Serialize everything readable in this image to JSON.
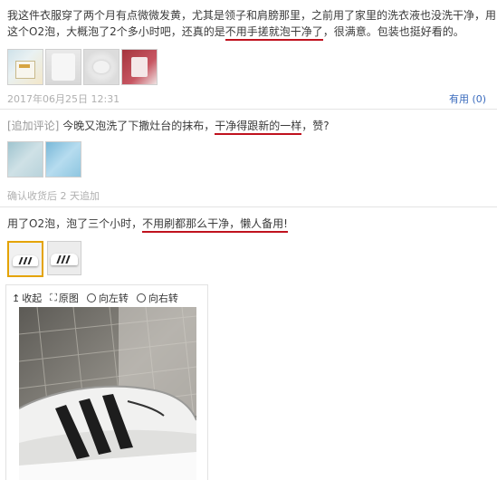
{
  "review1": {
    "line1_a": "我这件衣服穿了两个月有点微微发黄，尤其是领子和肩膀那里，之前用了家里的洗衣液也没洗干净，用",
    "line2_a": "这个O2泡，大概泡了2个多小时吧，还真的是",
    "line2_highlight": "不用手搓就泡干净了",
    "line2_b": "，很满意。包装也挺好看的。",
    "date": "2017年06月25日 12:31",
    "useful": "有用 (0)"
  },
  "followup": {
    "tag": "[追加评论]",
    "text_a": "今晚又泡洗了下撒灶台的抹布，",
    "text_highlight": "干净得跟新的一样",
    "text_b": "，赞?",
    "time": "确认收货后 2 天追加"
  },
  "review2": {
    "text_a": "用了O2泡，泡了三个小时，",
    "text_highlight": "不用刷都那么干净，懒人备用!",
    "toolbar": {
      "collapse": "收起",
      "original": "原图",
      "rotate_left": "向左转",
      "rotate_right": "向右转"
    }
  },
  "colors": {
    "underline": "#c0121e",
    "link": "#3a6bbd",
    "meta": "#b0b0b0"
  }
}
